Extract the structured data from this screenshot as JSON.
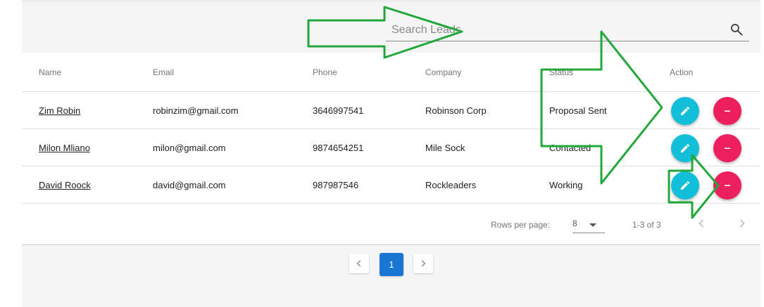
{
  "search": {
    "placeholder": "Search Leads",
    "icon": "search-icon"
  },
  "table": {
    "columns": [
      "Name",
      "Email",
      "Phone",
      "Company",
      "Status",
      "Action"
    ],
    "rows": [
      {
        "name": "Zim Robin",
        "email": "robinzim@gmail.com",
        "phone": "3646997541",
        "company": "Robinson Corp",
        "status": "Proposal Sent"
      },
      {
        "name": "Milon Mliano",
        "email": "milon@gmail.com",
        "phone": "9874654251",
        "company": "Mile Sock",
        "status": "Contacted"
      },
      {
        "name": "David Roock",
        "email": "david@gmail.com",
        "phone": "987987546",
        "company": "Rockleaders",
        "status": "Working"
      }
    ]
  },
  "footer": {
    "rows_per_page_label": "Rows per page:",
    "rows_per_page_value": "8",
    "range": "1-3 of 3"
  },
  "pagination": {
    "current_page": "1"
  },
  "colors": {
    "edit": "#13bfd8",
    "delete": "#ee1f5d",
    "primary": "#1976d2",
    "annotation_arrow": "#22a83a"
  }
}
